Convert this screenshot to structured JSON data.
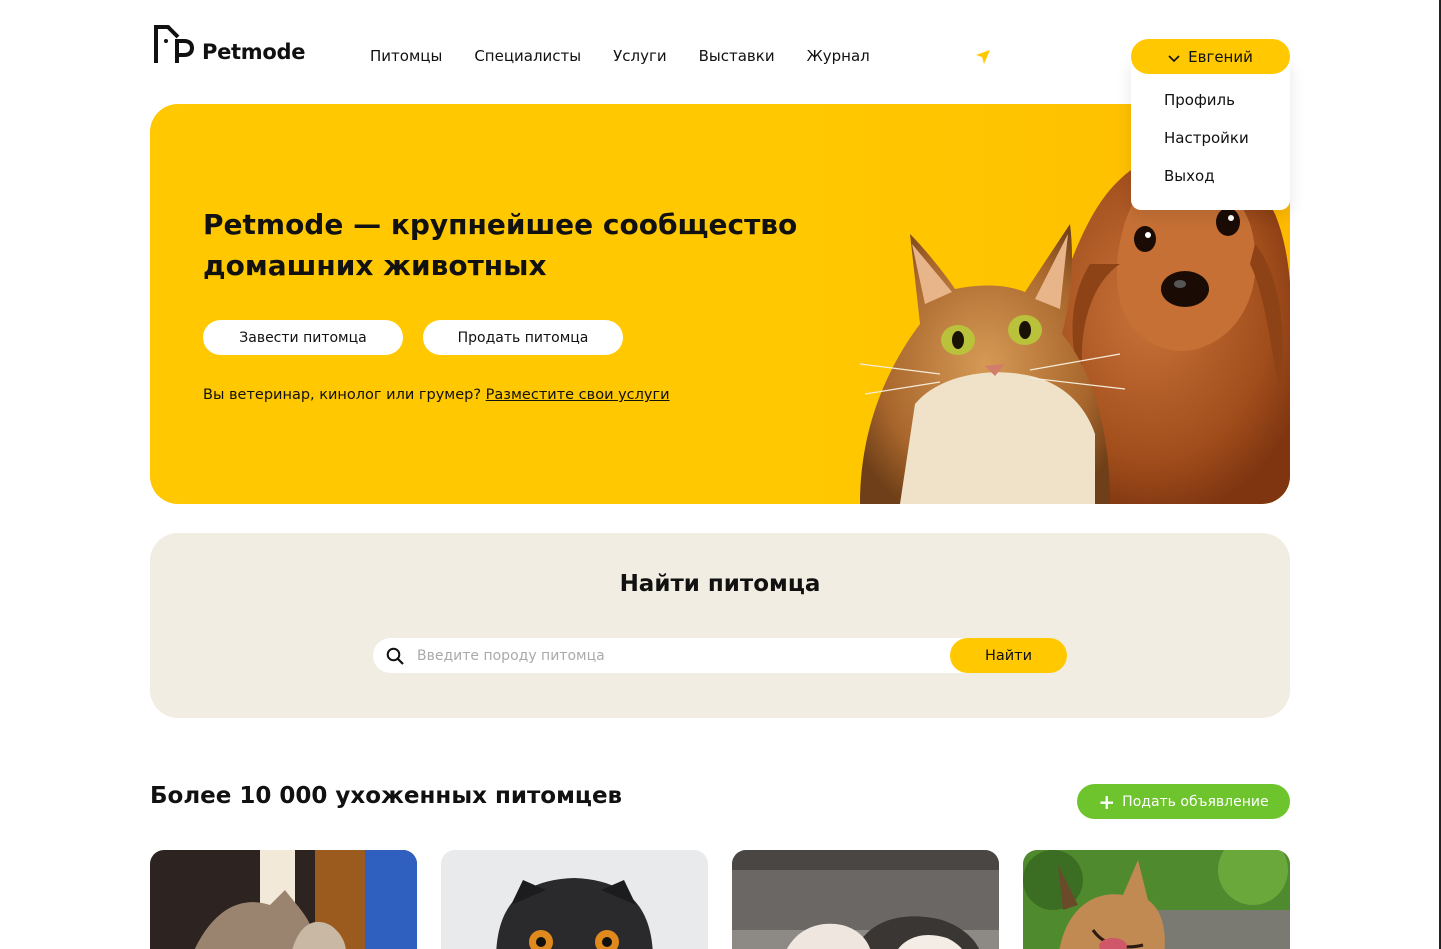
{
  "header": {
    "logo_text": "Petmode",
    "nav": [
      {
        "label": "Питомцы"
      },
      {
        "label": "Специалисты"
      },
      {
        "label": "Услуги"
      },
      {
        "label": "Выставки"
      },
      {
        "label": "Журнал"
      }
    ],
    "location_icon": "location-arrow-icon",
    "user": {
      "name": "Евгений",
      "menu": [
        {
          "label": "Профиль"
        },
        {
          "label": "Настройки"
        },
        {
          "label": "Выход"
        }
      ]
    }
  },
  "hero": {
    "title_line1": "Petmode — крупнейшее сообщество",
    "title_line2": "домашних животных",
    "btn_adopt": "Завести питомца",
    "btn_sell": "Продать питомца",
    "note": "Вы ветеринар, кинолог или грумер?",
    "note_link": "Разместите свои услуги"
  },
  "search": {
    "title": "Найти питомца",
    "placeholder": "Введите породу питомца",
    "button": "Найти"
  },
  "listing": {
    "title": "Более 10 000 ухоженных питомцев",
    "add_button": "Подать объявление"
  },
  "colors": {
    "accent": "#ffc800",
    "green": "#6dc42c",
    "beige": "#f2ede2"
  }
}
